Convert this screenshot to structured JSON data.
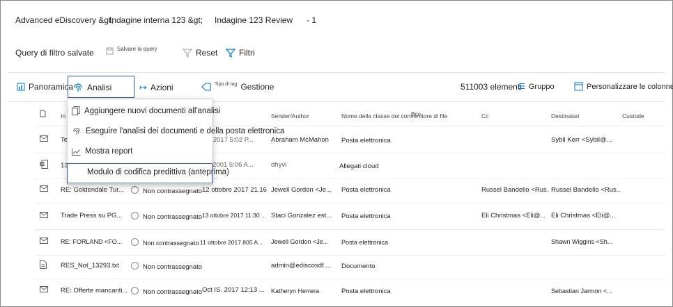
{
  "breadcrumb": {
    "part1": "Advanced eDiscovery &gt;",
    "part2": "Indagine interna 123 &gt;",
    "part3": "Indagine 123 Review",
    "part4": "- 1"
  },
  "toolbar": {
    "saved_queries_label": "Query di filtro salvate",
    "save_query_label": "Salvare la query",
    "reset_label": "Reset",
    "filters_label": "Filtri"
  },
  "nav": {
    "overview_label": "Panoramica",
    "analytics_label": "Analisi",
    "actions_label": "Azioni",
    "tag_type_label": "Tipo di tag",
    "manage_label": "Gestione",
    "item_count": "511003 elementi",
    "group_label": "Gruppo",
    "customize_columns_label": "Personalizzare le colonne"
  },
  "analytics_menu": {
    "items": [
      "Aggiungere nuovi documenti all'analisi",
      "Eseguire l'analisi dei documenti e della posta elettronica",
      "Mostra report",
      "Modulo di codifica predittiva (anteprima)"
    ]
  },
  "table": {
    "headers": {
      "subject": "In tal caso:",
      "sender": "Sender/Author",
      "class_name": "Nome della classe del convertitore di file",
      "bcc": "Bcc",
      "cc": "Cc",
      "recipients": "Destinatari",
      "custodian": "Custode"
    },
    "rows": [
      {
        "icon": "mail-icon",
        "subject": "Te",
        "tag": "",
        "date": "14, 2017 5:02 P...",
        "sender": "Abraham McMahon",
        "class": "Posta elettronica",
        "cc": "",
        "recipients": "Sybil Kerr <Sybil@..."
      },
      {
        "icon": "word-doc-icon",
        "subject": "13",
        "tag": "",
        "date": "11, 2001 5:06 A...",
        "sender": "dhyvl",
        "class": "Allegati cloud",
        "cc": "",
        "recipients": ""
      },
      {
        "icon": "mail-icon",
        "subject": "RE: Goldendale Tur...",
        "tag": "Non contrassegnato",
        "date": "12 ottobre 2017 21.16",
        "sender": "Jewell Gordon <Je...",
        "class": "Posta elettronica",
        "cc": "Russel Bandello <Rus...",
        "recipients": "Russel Bandello <Rus..."
      },
      {
        "icon": "mail-icon",
        "subject": "Trade Press su PG...",
        "tag": "Non contrassegnato",
        "date": "13 ottobre 2017 11:30 ...",
        "sender": "Staci Gonzalez est...",
        "class": "Posta elettronica",
        "cc": "Eli Christmas <Eli@...",
        "recipients": "Eli Christmas <Eli@..."
      },
      {
        "icon": "mail-icon",
        "subject": "RE: FORLAND <FO...",
        "tag": "Non contrassegnato",
        "date": "11 ottobre 2017 805 A...",
        "sender": "Jewell Gordon <Je...",
        "class": "Posta elettronica",
        "cc": "",
        "recipients": "Shawn Wiggins <Sh..."
      },
      {
        "icon": "document-icon",
        "subject": "RES_Not_13293.txt",
        "tag": "Non contrassegnato",
        "date": "",
        "sender": "admin@ediscosdf....",
        "class": "Documento",
        "cc": "",
        "recipients": ""
      },
      {
        "icon": "mail-icon",
        "subject": "RE: Offerte mancanti...",
        "tag": "Non contrassegnato",
        "date": "Oct IS. 2017 12:13 ...",
        "sender": "Katheryn Herrera",
        "class": "Posta elettronica",
        "cc": "",
        "recipients": "Sebastian Jarmon <..."
      }
    ]
  }
}
